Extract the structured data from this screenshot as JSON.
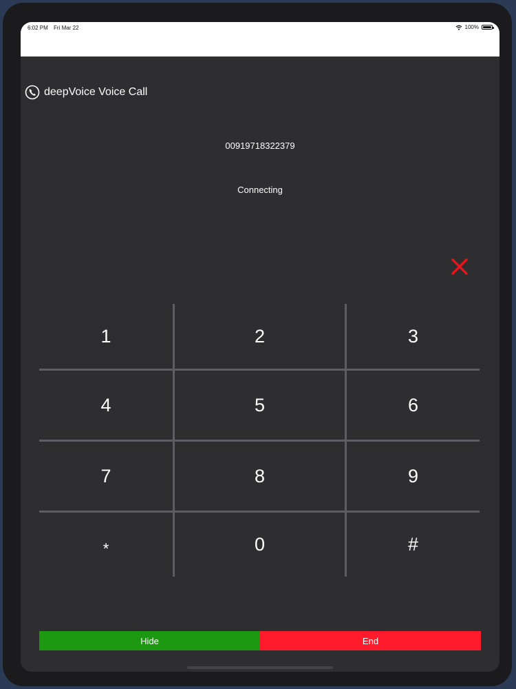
{
  "status_bar": {
    "time": "6:02 PM",
    "date": "Fri Mar 22",
    "battery": "100%",
    "icons": [
      "wifi-icon",
      "battery-icon"
    ]
  },
  "app": {
    "title": "deepVoice Voice Call",
    "icon": "phone-icon"
  },
  "call": {
    "number": "00919718322379",
    "status": "Connecting"
  },
  "close_icon": "close-icon",
  "keypad": {
    "keys": [
      "1",
      "2",
      "3",
      "4",
      "5",
      "6",
      "7",
      "8",
      "9",
      "*",
      "0",
      "#"
    ]
  },
  "actions": {
    "hide_label": "Hide",
    "end_label": "End"
  },
  "colors": {
    "background": "#2e2d30",
    "hide_button": "#1c9911",
    "end_button": "#ff1a2c",
    "close_icon": "#e8141c",
    "divider": "#5e5d63"
  }
}
